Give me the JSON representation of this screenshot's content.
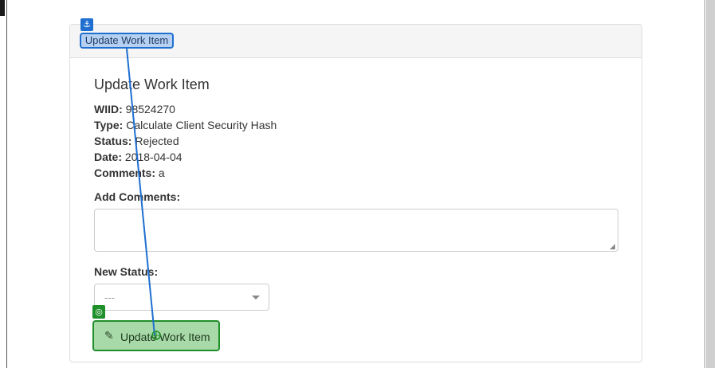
{
  "panel": {
    "heading": "Update Work Item"
  },
  "form": {
    "title": "Update Work Item",
    "wiid_label": "WIID:",
    "wiid_value": "98524270",
    "type_label": "Type:",
    "type_value": "Calculate Client Security Hash",
    "status_label": "Status:",
    "status_value": "Rejected",
    "date_label": "Date:",
    "date_value": "2018-04-04",
    "comments_label": "Comments:",
    "comments_value": "a",
    "add_comments_label": "Add Comments:",
    "add_comments_value": "",
    "new_status_label": "New Status:",
    "new_status_selected": "---",
    "submit_label": "Update Work Item"
  },
  "icons": {
    "anchor": "anchor-icon",
    "target": "target-icon",
    "pencil": "pencil-icon",
    "caret": "chevron-down-icon"
  },
  "colors": {
    "anchor_highlight": "#1f6fd1",
    "target_highlight": "#1f8f2a",
    "button_fill": "#a8d9a8"
  }
}
